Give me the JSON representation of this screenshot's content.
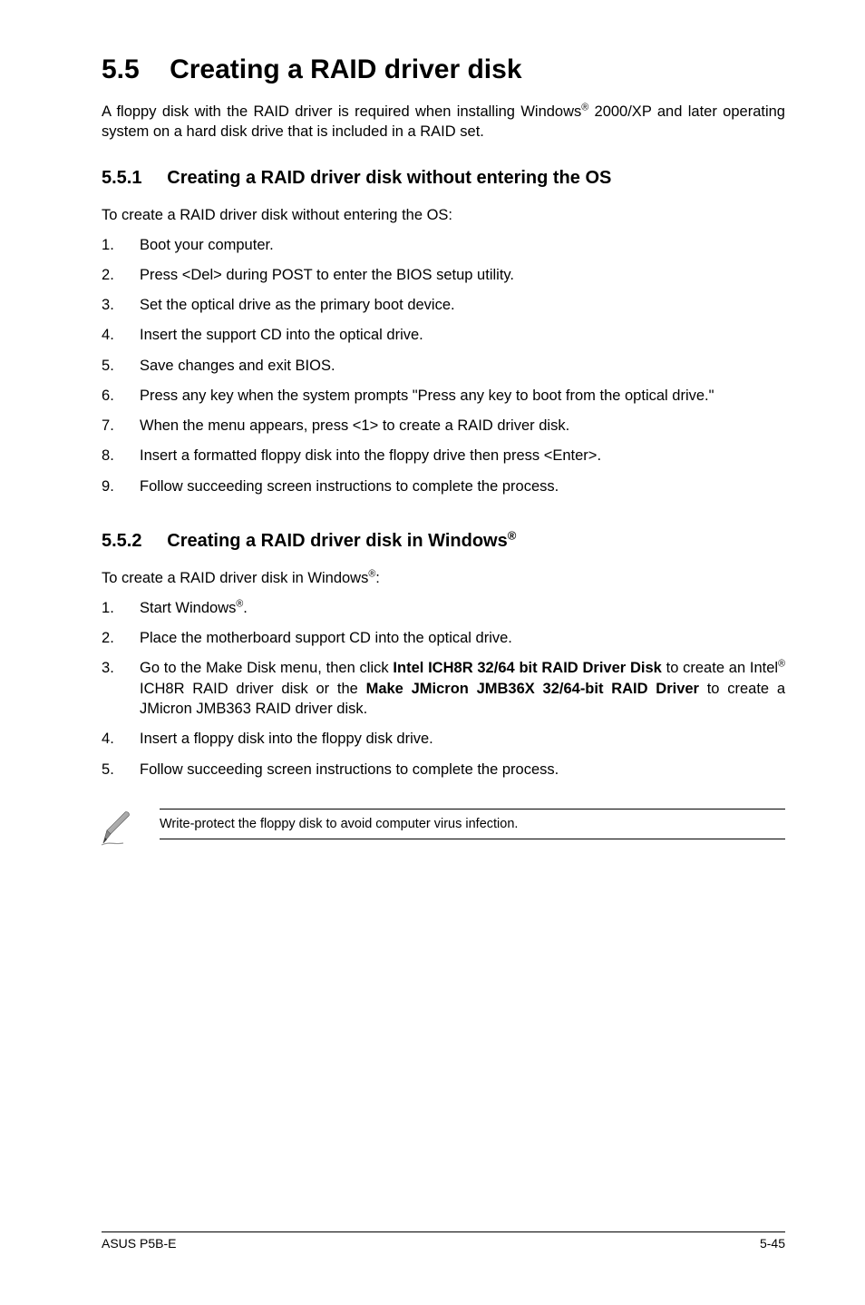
{
  "heading": {
    "number": "5.5",
    "title": "Creating a RAID driver disk"
  },
  "intro_parts": {
    "p1": "A floppy disk with the RAID driver is required when installing Windows",
    "sup1": "®",
    "p2": " 2000/XP and later operating system on a hard disk drive that is included in a RAID set."
  },
  "section1": {
    "number": "5.5.1",
    "title": "Creating a RAID driver disk without entering the OS",
    "lead": "To create a RAID driver disk without entering the OS:",
    "items": [
      "Boot your computer.",
      "Press <Del> during POST to enter the BIOS setup utility.",
      "Set the optical drive as the primary boot device.",
      "Insert the support CD into the optical drive.",
      "Save changes and exit BIOS.",
      "Press any key when the system prompts \"Press any key to boot from the optical drive.\"",
      "When the menu appears, press <1> to create a RAID driver disk.",
      "Insert a formatted floppy disk into the floppy drive then press <Enter>.",
      "Follow succeeding screen instructions to complete the process."
    ]
  },
  "section2": {
    "number": "5.5.2",
    "title_parts": {
      "t1": "Creating a RAID driver disk in Windows",
      "sup": "®"
    },
    "lead_parts": {
      "l1": "To create a RAID driver disk in Windows",
      "sup": "®",
      "l2": ":"
    },
    "items": {
      "i1": {
        "p1": "Start Windows",
        "sup": "®",
        "p2": "."
      },
      "i2": "Place the motherboard support CD into the optical drive.",
      "i3": {
        "p1": "Go to the Make Disk menu, then click ",
        "b1": "Intel ICH8R 32/64 bit RAID Driver Disk",
        "p2": " to create an Intel",
        "sup": "®",
        "p3": " ICH8R RAID driver disk or the ",
        "b2": "Make JMicron JMB36X 32/64-bit RAID Driver",
        "p4": " to create a JMicron JMB363 RAID driver disk."
      },
      "i4": "Insert a floppy disk into the floppy disk drive.",
      "i5": "Follow succeeding screen instructions to complete the process."
    }
  },
  "note": "Write-protect the floppy disk to avoid computer virus infection.",
  "footer": {
    "left": "ASUS P5B-E",
    "right": "5-45"
  }
}
